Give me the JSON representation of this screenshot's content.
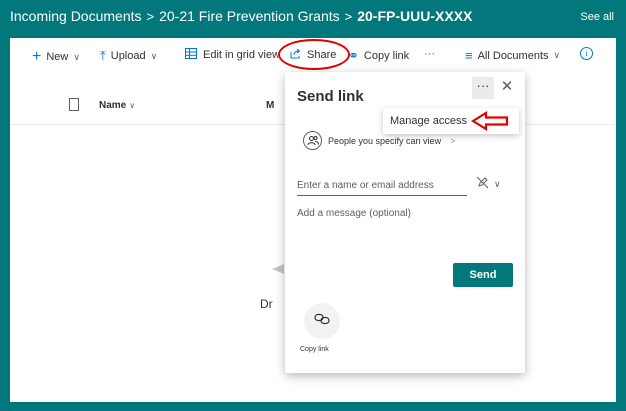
{
  "header": {
    "breadcrumb": [
      "Incoming Documents",
      "20-21 Fire Prevention Grants",
      "20-FP-UUU-XXXX"
    ],
    "separator": ">",
    "see_all": "See all"
  },
  "command_bar": {
    "new_label": "New",
    "upload_label": "Upload",
    "edit_grid_label": "Edit in grid view",
    "share_label": "Share",
    "copy_link_label": "Copy link",
    "more_label": "···",
    "view_label": "All Documents",
    "info_label": "i"
  },
  "list": {
    "columns": [
      "Name",
      "M"
    ],
    "empty_text": "Dr"
  },
  "share_panel": {
    "title": "Send link",
    "more_label": "···",
    "close_label": "✕",
    "menu_items": [
      "Manage access"
    ],
    "people_scope": "People you specify can view",
    "email_placeholder": "Enter a name or email address",
    "message_placeholder": "Add a message (optional)",
    "send_label": "Send",
    "copy_link_label": "Copy link"
  },
  "colors": {
    "brand": "#03787c",
    "accent": "#0078d4",
    "annotation": "#e00000"
  },
  "icons": [
    "plus-icon",
    "upload-icon",
    "grid-icon",
    "share-icon",
    "link-icon",
    "filter-icon",
    "info-icon",
    "document-icon",
    "people-icon",
    "pencil-off-icon",
    "arrow-left-icon"
  ]
}
